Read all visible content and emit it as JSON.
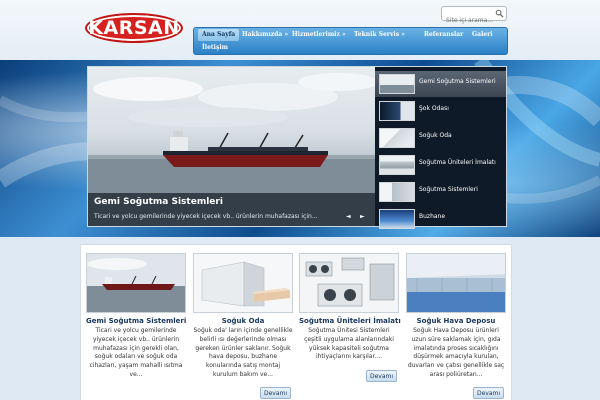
{
  "brand": {
    "logo_text": "KARSAN"
  },
  "search": {
    "placeholder": "Site içi arama..."
  },
  "nav": {
    "items": [
      {
        "label": "Ana Sayfa"
      },
      {
        "label": "Hakkımızda »"
      },
      {
        "label": "Hizmetlerimiz »"
      },
      {
        "label": "Teknik Servis »"
      },
      {
        "label": "Referanslar"
      },
      {
        "label": "Galeri"
      },
      {
        "label": "İletişim"
      }
    ]
  },
  "slider": {
    "title": "Gemi Soğutma Sistemleri",
    "description": "Ticari ve yolcu gemilerinde yiyecek içecek vb.. ürünlerin muhafazası için...",
    "prev_icon": "◄",
    "next_icon": "►",
    "thumbs": [
      {
        "label": "Gemi Soğutma Sistemleri"
      },
      {
        "label": "Şok Odası"
      },
      {
        "label": "Soğuk Oda"
      },
      {
        "label": "Soğutma Üniteleri İmalatı"
      },
      {
        "label": "Soğutma Sistemleri"
      },
      {
        "label": "Buzhane"
      }
    ]
  },
  "cards": [
    {
      "title": "Gemi Soğutma Sistemleri",
      "text": "Ticari ve yolcu gemilerinde yiyecek içecek vb.. ürünlerin muhafazası için gerekli olan, soğuk odaları ve soğuk oda cihazları, yaşam mahalli ısıtma ve...",
      "button": "Devamı"
    },
    {
      "title": "Soğuk Oda",
      "text": "Soğuk oda' ların içinde genellikle belirli ısı değerlerinde olması gereken ürünler saklanır. Soğuk hava deposu, buzhane konularında  satış montaj kurulum bakım ve...",
      "button": "Devamı"
    },
    {
      "title": "Soğutma Üniteleri İmalatı",
      "text": "Soğutma Ünitesi Sistemleri çeşitli uygulama alanlarındaki yüksek kapasiteli soğutma ihtiyaçlarını karşılar....",
      "button": "Devamı"
    },
    {
      "title": "Soğuk Hava Deposu",
      "text": "Soğuk Hava Deposu ürünleri uzun süre saklamak için, gıda imalatında proses sıcaklığını düşürmek amacıyla kurulan, duvarları ve çatısı genellikle saç arası poliüretan...",
      "button": "Devamı"
    }
  ],
  "colors": {
    "accent": "#2b80c6",
    "brand_red": "#d6211e",
    "title_blue": "#17365d"
  }
}
